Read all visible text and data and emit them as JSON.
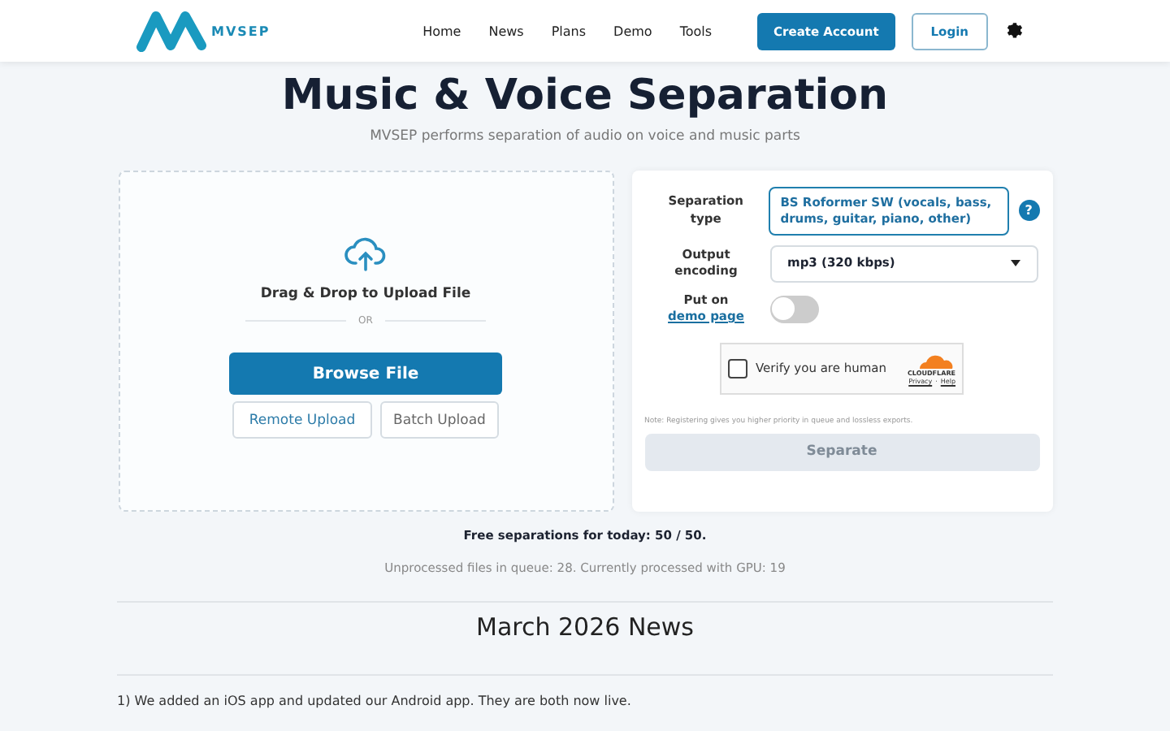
{
  "header": {
    "logo_text": "MVSEP",
    "nav": [
      {
        "label": "Home"
      },
      {
        "label": "News"
      },
      {
        "label": "Plans"
      },
      {
        "label": "Demo"
      },
      {
        "label": "Tools"
      }
    ],
    "create_account": "Create Account",
    "login": "Login"
  },
  "title": "Music & Voice Separation",
  "subtitle": "MVSEP performs separation of audio on voice and music parts",
  "upload": {
    "drop_text": "Drag & Drop to Upload File",
    "or": "OR",
    "browse": "Browse File",
    "remote": "Remote Upload",
    "batch": "Batch Upload"
  },
  "form": {
    "sep_label": "Separation type",
    "sep_value": "BS Roformer SW (vocals, bass, drums, guitar, piano, other)",
    "help": "?",
    "enc_label": "Output encoding",
    "enc_value": "mp3 (320 kbps)",
    "demo_label": "Put on",
    "demo_link": "demo page",
    "demo_on": false,
    "captcha": {
      "label": "Verify you are human",
      "brand": "CLOUDFLARE",
      "privacy": "Privacy",
      "sep": "·",
      "help": "Help",
      "checked": false
    },
    "note": "Note: Registering gives you higher priority in queue and lossless exports.",
    "separate": "Separate",
    "separate_disabled": true
  },
  "free": "Free separations for today: 50 / 50.",
  "queue": "Unprocessed files in queue: 28. Currently processed with GPU: 19",
  "news_title": "March 2026 News",
  "news_items": [
    "1) We added an iOS app and updated our Android app. They are both now live."
  ]
}
